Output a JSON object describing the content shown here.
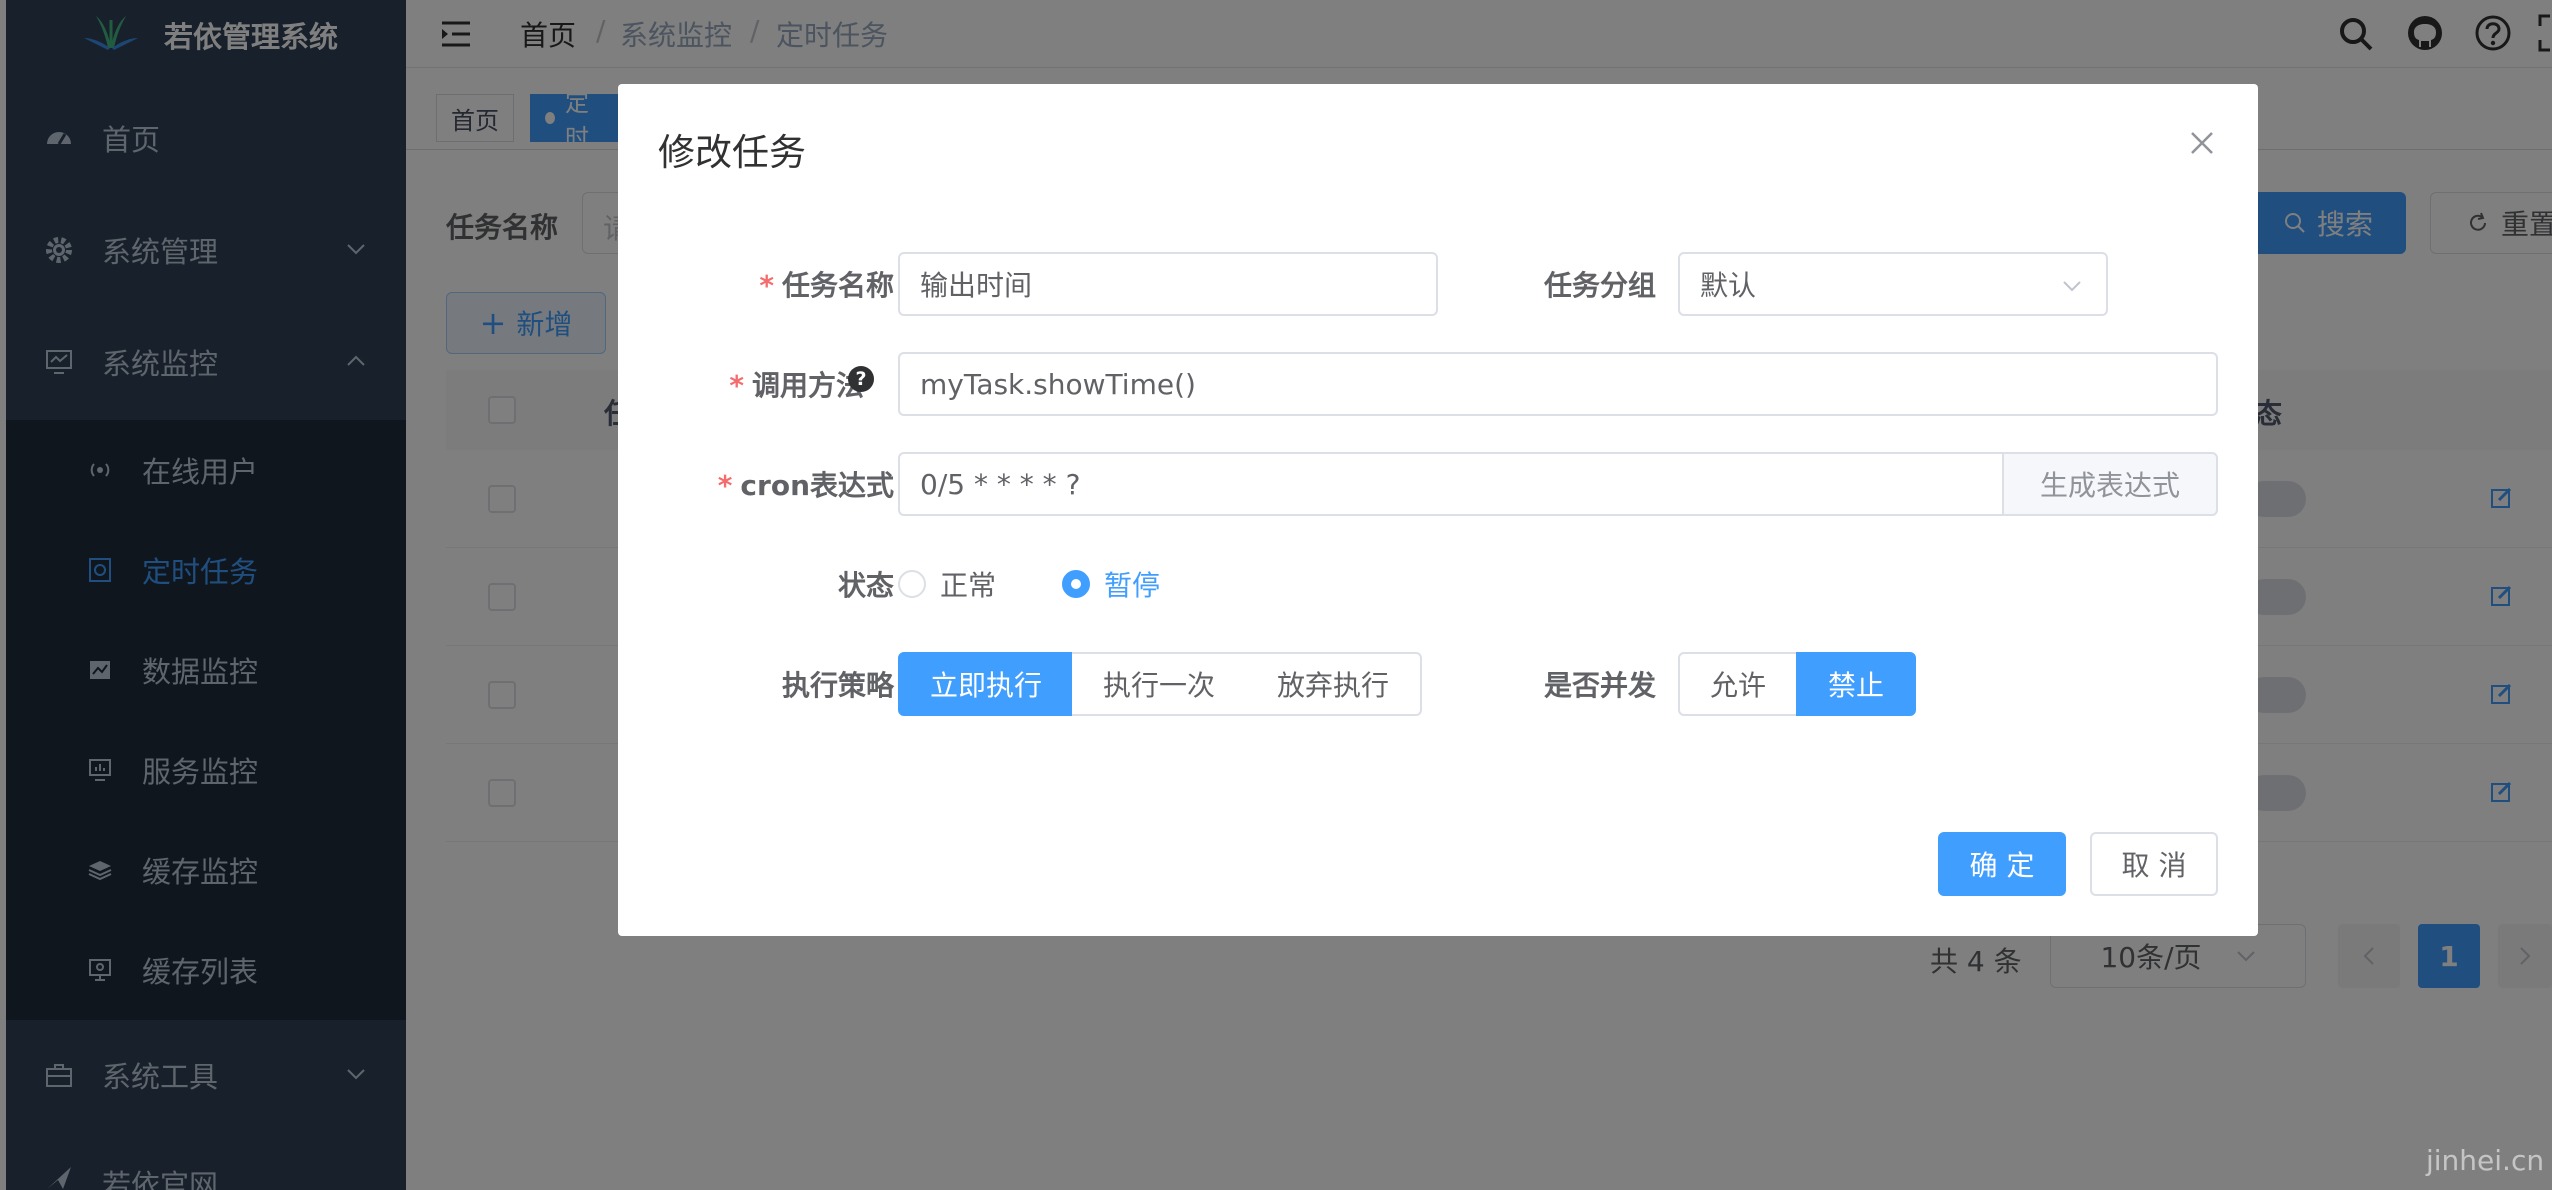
{
  "sidebar": {
    "title": "若依管理系统",
    "menu": [
      {
        "label": "首页",
        "icon": "dashboard-icon"
      },
      {
        "label": "系统管理",
        "icon": "gear-icon"
      },
      {
        "label": "系统监控",
        "icon": "monitor-icon"
      }
    ],
    "submenu": [
      {
        "label": "在线用户",
        "icon": "online-icon"
      },
      {
        "label": "定时任务",
        "icon": "job-icon",
        "active": true
      },
      {
        "label": "数据监控",
        "icon": "druid-icon"
      },
      {
        "label": "服务监控",
        "icon": "server-icon"
      },
      {
        "label": "缓存监控",
        "icon": "redis-icon"
      },
      {
        "label": "缓存列表",
        "icon": "redis-list-icon"
      }
    ],
    "tools": {
      "label": "系统工具",
      "icon": "tool-icon"
    },
    "website": {
      "label": "若依官网",
      "icon": "guide-icon"
    }
  },
  "header": {
    "breadcrumb": [
      "首页",
      "系统监控",
      "定时任务"
    ],
    "separator": "/",
    "icons": [
      "search-icon",
      "github-icon",
      "question-icon",
      "fullscreen-icon"
    ]
  },
  "tags": {
    "home": "首页",
    "current": "定时"
  },
  "query": {
    "task_name_label": "任务名称",
    "task_name_placeholder": "请",
    "search_label": "搜索",
    "reset_label": "重置"
  },
  "toolbar": {
    "add_label": "新增"
  },
  "table": {
    "status_header_fragment": "状态",
    "first_col_fragment": "任",
    "rows": 4
  },
  "pagination": {
    "total": "共 4 条",
    "page_size": "10条/页",
    "current_page": "1"
  },
  "dialog": {
    "title": "修改任务",
    "job_name_label": "任务名称",
    "job_name_value": "输出时间",
    "job_group_label": "任务分组",
    "job_group_value": "默认",
    "invoke_label": "调用方法",
    "invoke_value": "myTask.showTime()",
    "cron_label": "cron表达式",
    "cron_value": "0/5 * * * * ?",
    "cron_button": "生成表达式",
    "status_label": "状态",
    "status_options": [
      "正常",
      "暂停"
    ],
    "status_selected": "暂停",
    "policy_label": "执行策略",
    "policy_options": [
      "立即执行",
      "执行一次",
      "放弃执行"
    ],
    "policy_selected": "立即执行",
    "concurrent_label": "是否并发",
    "concurrent_options": [
      "允许",
      "禁止"
    ],
    "concurrent_selected": "禁止",
    "confirm_label": "确 定",
    "cancel_label": "取 消"
  },
  "watermark": "jinhei.cn",
  "colors": {
    "primary": "#409eff",
    "sidebar": "#304156",
    "sidebar_sub": "#1f2d3d",
    "danger": "#f56c6c"
  }
}
